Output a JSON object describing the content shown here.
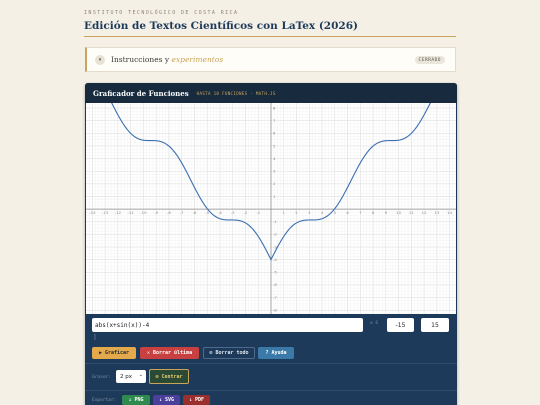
{
  "header": {
    "institution": "INSTITUTO TECNOLÓGICO DE COSTA RICA",
    "title": "Edición de Textos Científicos con LaTex (2026)"
  },
  "instructions": {
    "toggle_icon": "▾",
    "label_prefix": "Instrucciones y ",
    "label_highlight": "experimentos",
    "badge": "CERRADO"
  },
  "app": {
    "title": "Graficador de Funciones",
    "subtitle": "HASTA 10 FUNCIONES · MATH.JS"
  },
  "controls": {
    "function_value": "abs(x+sin(x))-4",
    "x_range_label": "x ∈",
    "x_min": "-15",
    "x_max": "15",
    "caret": "]",
    "graph_button": "▶ Graficar",
    "delete_last_button": "✕ Borrar última",
    "delete_all_button": "⊘ Borrar todo",
    "help_button": "? Ayuda",
    "thickness_label": "Grosor:",
    "thickness_value": "2 px",
    "center_button": "⊕ Centrar",
    "export_label": "Exportar:",
    "png_button": "↓ PNG",
    "svg_button": "↓ SVG",
    "pdf_button": "↓ PDF"
  },
  "colors": {
    "accent": "#c9a45a",
    "navy": "#1e3a5a",
    "curve": "#3b6fb0"
  },
  "chart_data": {
    "type": "line",
    "function": "abs(x+sin(x))-4",
    "xlim": [
      -14.5,
      14.5
    ],
    "ylim": [
      -8.3,
      8.4
    ],
    "x_ticks": [
      -14,
      -13,
      -12,
      -11,
      -10,
      -9,
      -8,
      -7,
      -6,
      -5,
      -4,
      -3,
      -2,
      -1,
      1,
      2,
      3,
      4,
      5,
      6,
      7,
      8,
      9,
      10,
      11,
      12,
      13,
      14
    ],
    "y_ticks": [
      8,
      7,
      6,
      5,
      4,
      3,
      2,
      1,
      -1,
      -2,
      -3,
      -4,
      -5,
      -6,
      -7,
      -8
    ],
    "grid": true
  }
}
